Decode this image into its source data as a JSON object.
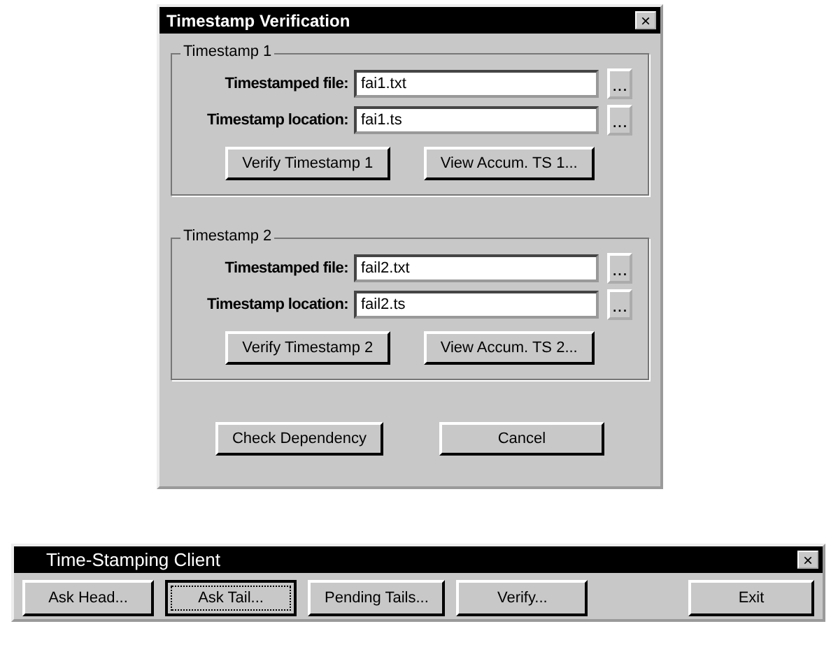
{
  "dialog": {
    "title": "Timestamp Verification",
    "close": "×",
    "groups": [
      {
        "title": "Timestamp 1",
        "fields": [
          {
            "label": "Timestamped file:",
            "value": "fai1.txt",
            "browse": "..."
          },
          {
            "label": "Timestamp location:",
            "value": "fai1.ts",
            "browse": "..."
          }
        ],
        "buttons": [
          "Verify Timestamp 1",
          "View Accum. TS 1..."
        ]
      },
      {
        "title": "Timestamp 2",
        "fields": [
          {
            "label": "Timestamped file:",
            "value": "fail2.txt",
            "browse": "..."
          },
          {
            "label": "Timestamp location:",
            "value": "fail2.ts",
            "browse": "..."
          }
        ],
        "buttons": [
          "Verify Timestamp 2",
          "View Accum. TS 2..."
        ]
      }
    ],
    "buttons": [
      "Check Dependency",
      "Cancel"
    ]
  },
  "client": {
    "title": "Time-Stamping Client",
    "close": "×",
    "buttons": [
      {
        "label": "Ask Head...",
        "focused": false
      },
      {
        "label": "Ask Tail...",
        "focused": true
      },
      {
        "label": "Pending Tails...",
        "focused": false
      },
      {
        "label": "Verify...",
        "focused": false
      },
      {
        "label": "Exit",
        "focused": false
      }
    ]
  }
}
